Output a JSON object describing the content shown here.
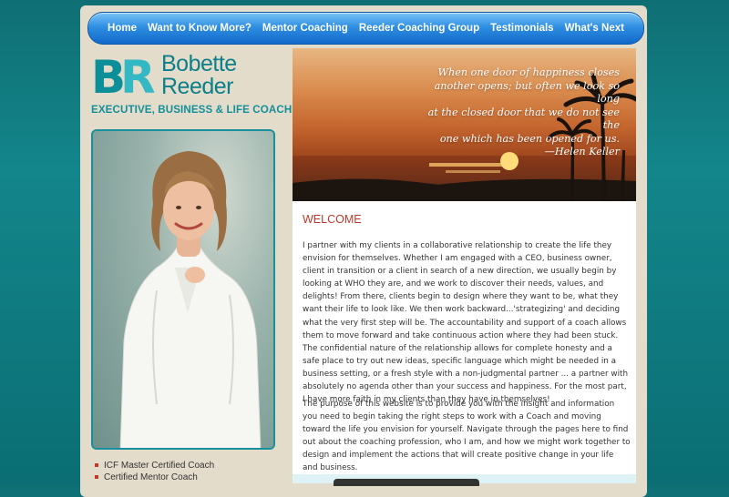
{
  "nav": {
    "items": [
      "Home",
      "Want to Know More?",
      "Mentor Coaching",
      "Reeder Coaching Group",
      "Testimonials",
      "What's Next"
    ]
  },
  "logo": {
    "monogram_b": "B",
    "monogram_r": "R",
    "first_name": "Bobette",
    "last_name": "Reeder",
    "tagline": "EXECUTIVE, BUSINESS & LIFE COACH"
  },
  "credentials": [
    "ICF Master Certified Coach",
    "Certified Mentor Coach"
  ],
  "hero": {
    "quote_lines": [
      "When one door of happiness closes",
      "another opens; but often we look so long",
      "at the closed door that we do not see the",
      "one which has been opened for us.",
      "—Helen Keller"
    ]
  },
  "welcome": {
    "heading": "WELCOME",
    "para1": "I partner with my clients in a collaborative relationship to create the life they envision for themselves. Whether I am engaged with a CEO, business owner, client in transition or a client in search of a new direction, we usually begin by looking at WHO they are, and we work to discover their needs, values, and delights! From there, clients begin to design where they want to be, what they want their life to look like. We then work backward...'strategizing' and deciding what the very first step will be. The accountability and support of a coach allows them to move forward and take continuous action where they had been stuck. The confidential nature of the relationship allows for complete honesty and a safe place to try out new ideas, specific language which might be needed in a business setting, or a fresh style with a non-judgmental partner ... a partner with absolutely no agenda other than your success and happiness. For the most part, I have more faith in my clients than they have in themselves!",
    "para2": "The purpose of this website is to provide you with the insight and information you need to begin taking the right steps to work with a Coach and moving toward the life you envision for yourself. Navigate through the pages here to find out about the coaching profession, who I am, and how we might work together to design and implement the actions that will create positive change in your life and business."
  },
  "colors": {
    "accent": "#0d8f9a",
    "heading_red": "#c0392b",
    "nav_blue": "#2f8fe2",
    "page_bg": "#e4dccb"
  }
}
